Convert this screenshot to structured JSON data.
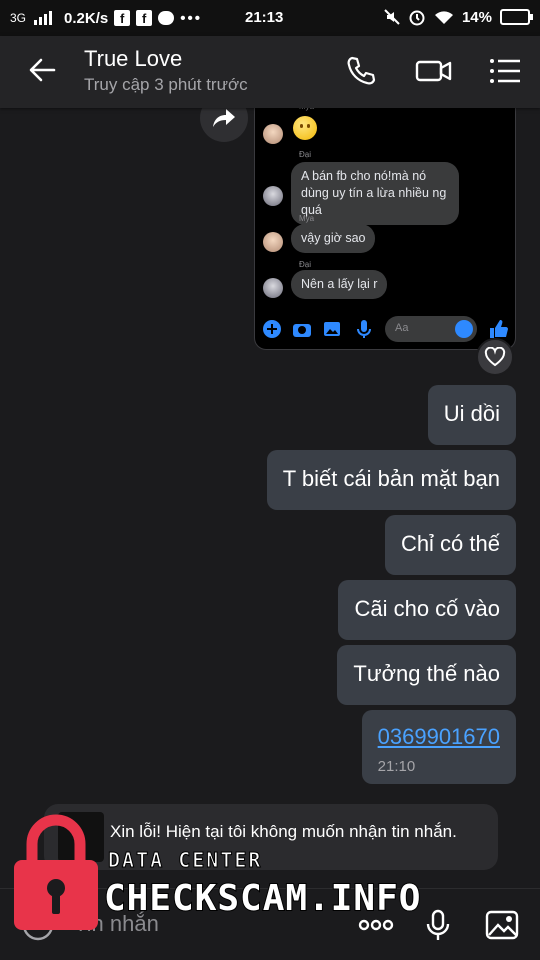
{
  "status_bar": {
    "network": "3G",
    "speed": "0.2K/s",
    "fb1": "f",
    "fb2": "f",
    "dots": "•••",
    "time": "21:13",
    "battery": "14%"
  },
  "header": {
    "title": "True Love",
    "subtitle": "Truy cập 3 phút trước",
    "icons": [
      "back-arrow-icon",
      "phone-icon",
      "video-icon",
      "menu-icon"
    ]
  },
  "embedded_chat": {
    "messages": [
      {
        "sender": "Mya",
        "type": "emoji",
        "text": ""
      },
      {
        "sender": "Đại",
        "type": "text",
        "text": "A bán fb cho nó!mà nó dùng uy tín a lừa nhiều ng quá"
      },
      {
        "sender": "Mya",
        "type": "text",
        "text": "vậy giờ sao"
      },
      {
        "sender": "Đại",
        "type": "text",
        "text": "Nên a lấy lại r"
      }
    ],
    "input_placeholder": "Aa"
  },
  "my_messages": [
    {
      "text": "Ui dồi"
    },
    {
      "text": "T biết cái bản mặt bạn"
    },
    {
      "text": "Chỉ có thế"
    },
    {
      "text": "Cãi cho cố vào"
    },
    {
      "text": "Tưởng thế nào"
    }
  ],
  "phone_message": {
    "number": "0369901670",
    "time": "21:10"
  },
  "notice": {
    "text": "Xin lỗi! Hiện tại tôi không muốn nhận tin nhắn."
  },
  "composer": {
    "placeholder": "Tin nhắn"
  },
  "watermark": {
    "line1": "DATA CENTER",
    "line2": "CHECKSCAM.INFO"
  },
  "colors": {
    "background": "#1b1b1d",
    "header": "#242426",
    "bubble": "#3a3f47",
    "link": "#4aa2ff",
    "messenger_blue": "#2e89ff",
    "lock_red": "#e8344a"
  }
}
